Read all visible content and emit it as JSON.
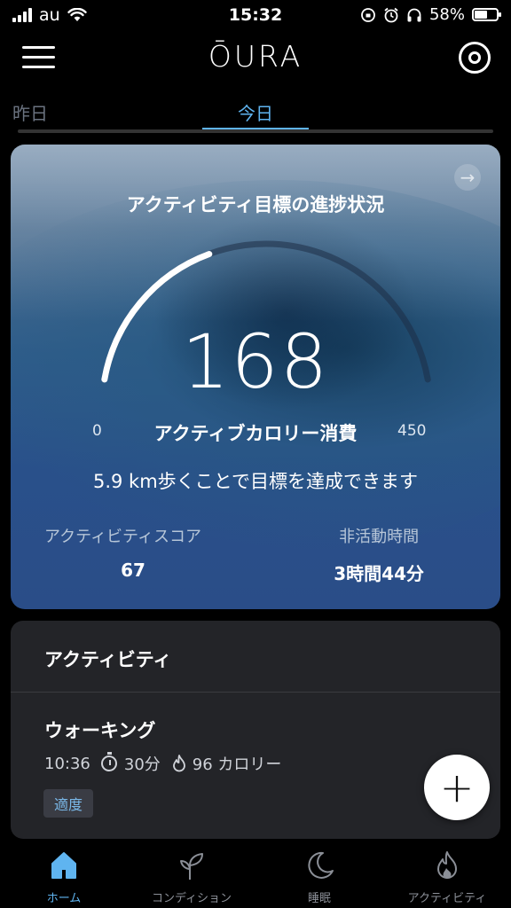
{
  "status_bar": {
    "carrier": "au",
    "time": "15:32",
    "battery": "58%",
    "battery_level": 0.58
  },
  "header": {
    "logo": "ŌURA"
  },
  "tabs": {
    "prev": "昨日",
    "current": "今日"
  },
  "hero": {
    "title": "アクティビティ目標の進捗状況",
    "value": "168",
    "gauge_min": "0",
    "gauge_max": "450",
    "gauge_fraction": 0.373,
    "gauge_label": "アクティブカロリー消費",
    "goal_text": "5.9 km歩くことで目標を達成できます",
    "stats": [
      {
        "label": "アクティビティスコア",
        "value": "67"
      },
      {
        "label": "非活動時間",
        "value": "3時間44分"
      }
    ]
  },
  "activity": {
    "section_title": "アクティビティ",
    "item": {
      "title": "ウォーキング",
      "time": "10:36",
      "duration": "30分",
      "calories": "96 カロリー",
      "intensity": "適度"
    }
  },
  "fab_label": "+",
  "bottom_nav": [
    {
      "label": "ホーム",
      "icon": "home-icon",
      "active": true
    },
    {
      "label": "コンディション",
      "icon": "sprout-icon",
      "active": false
    },
    {
      "label": "睡眠",
      "icon": "moon-icon",
      "active": false
    },
    {
      "label": "アクティビティ",
      "icon": "flame-icon",
      "active": false
    }
  ],
  "colors": {
    "accent": "#5fb4f0",
    "card": "#232428",
    "hero_top": "#7a93ad",
    "hero_bottom": "#2a4d88"
  }
}
